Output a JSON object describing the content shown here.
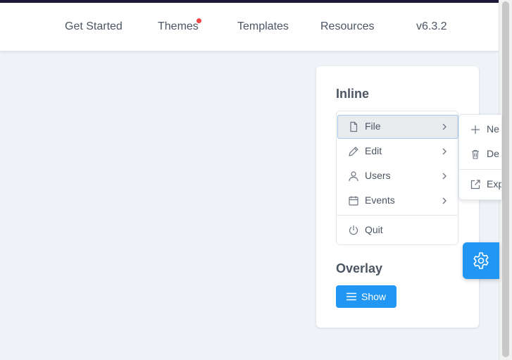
{
  "nav": {
    "items": [
      "Get Started",
      "Themes",
      "Templates",
      "Resources",
      "v6.3.2"
    ]
  },
  "panel": {
    "inline_title": "Inline",
    "overlay_title": "Overlay",
    "show_label": "Show"
  },
  "menu": {
    "items": [
      {
        "label": "File",
        "icon": "file-icon",
        "has_submenu": true
      },
      {
        "label": "Edit",
        "icon": "pencil-icon",
        "has_submenu": true
      },
      {
        "label": "Users",
        "icon": "user-icon",
        "has_submenu": true
      },
      {
        "label": "Events",
        "icon": "calendar-icon",
        "has_submenu": true
      },
      {
        "label": "Quit",
        "icon": "power-icon",
        "has_submenu": false
      }
    ]
  },
  "submenu": {
    "items": [
      {
        "label": "Ne",
        "icon": "plus-icon"
      },
      {
        "label": "De",
        "icon": "trash-icon"
      },
      {
        "label": "Exp",
        "icon": "external-link-icon"
      }
    ]
  },
  "colors": {
    "accent": "#2196f3",
    "topbar": "#1e1838",
    "notification_dot": "#ef4444",
    "background": "#eff3f8"
  }
}
